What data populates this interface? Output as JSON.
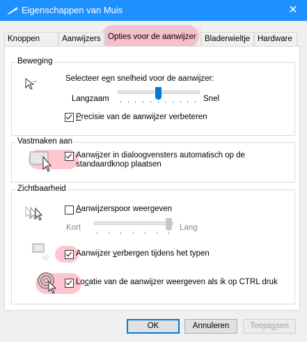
{
  "window": {
    "title": "Eigenschappen van Muis",
    "close_glyph": "✕"
  },
  "tabs": [
    {
      "label": "Knoppen"
    },
    {
      "label": "Aanwijzers"
    },
    {
      "label": "Opties voor de aanwijzer"
    },
    {
      "label": "Bladerwieltje"
    },
    {
      "label": "Hardware"
    }
  ],
  "beweging": {
    "group_label": "Beweging",
    "speed_label_pre": "Selecteer e",
    "speed_label_u": "e",
    "speed_label_post": "n snelheid voor de aanwijzer:",
    "slow": "Langzaam",
    "fast": "Snel",
    "speed_value_fraction": 0.5,
    "precision_pre": "",
    "precision_u": "P",
    "precision_post": "recisie van de aanwijzer verbeteren",
    "precision_checked": true
  },
  "vastmaken": {
    "group_label": "Vastmaken aan",
    "snap_u": "Aanw",
    "snap_u_letter": "ij",
    "snap_line1_rest": "zer in dialoogvensters automatisch op de",
    "snap_line2": "standaardknop plaatsen",
    "snap_checked": true
  },
  "zichtbaarheid": {
    "group_label": "Zichtbaarheid",
    "trail_u": "A",
    "trail_rest": "anwijzerspoor weergeven",
    "trail_checked": false,
    "short": "Kort",
    "long": "Lang",
    "trail_value_fraction": 1.0,
    "hide_pre": "Aanwijzer ",
    "hide_u": "v",
    "hide_rest": "erbergen tijdens het typen",
    "hide_checked": true,
    "locate_pre": "Lo",
    "locate_u": "c",
    "locate_rest": "atie van de aanwijzer weergeven als ik op CTRL druk",
    "locate_checked": true
  },
  "buttons": {
    "ok": "OK",
    "cancel": "Annuleren",
    "apply_pre": "Toepa",
    "apply_u": "s",
    "apply_post": "sen"
  },
  "colors": {
    "titlebar": "#1e90ff",
    "accent": "#0078d7",
    "highlight": "#ff96aa"
  }
}
